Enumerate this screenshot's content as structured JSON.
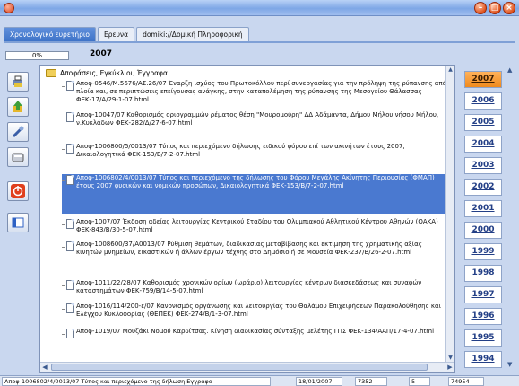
{
  "window": {
    "title": ""
  },
  "tabs": [
    {
      "label": "Χρονολογικό ευρετήριο"
    },
    {
      "label": "Ερευνα"
    },
    {
      "label": "domiki://Δομική Πληροφορική"
    }
  ],
  "progress": {
    "label": "0%",
    "value": 0
  },
  "current_year": "2007",
  "tree": {
    "folder": "Αποφάσεις, Εγκύκλιοι, Έγγραφα",
    "documents": [
      "Αποφ-0546/Μ.5676/ΑΣ.26/07 Έναρξη ισχύος του Πρωτοκόλλου περί συνεργασίας για την πρόληψη της ρύπανσης από πλοία και, σε περιπτώσεις επείγουσας ανάγκης, στην καταπολέμηση της ρύπανσης της Μεσογείου Θάλασσας ΦΕΚ-17/Α/29-1-07.html",
      "Αποφ-10047/07 Καθορισμός οριογραμμών ρέματος θέση \"Μουρομούρη\" ΔΔ Αδάμαντα, Δήμου Μήλου νήσου Μήλου, ν.Κυκλάδων ΦΕΚ-282/Δ/27-6-07.html",
      "Αποφ-1006800/5/0013/07 Τύπος και περιεχόμενο δήλωσης ειδικού φόρου επί των ακινήτων έτους 2007, Δικαιολογητικά ΦΕΚ-153/Β/7-2-07.html",
      "Αποφ-1006802/4/0013/07 Τύπος και περιεχόμενο της δήλωσης του Φόρου Μεγάλης Ακίνητης Περιουσίας (ΦΜΑΠ) έτους 2007 φυσικών και νομικών προσώπων, Δικαιολογητικά ΦΕΚ-153/Β/7-2-07.html",
      "Αποφ-1007/07 Έκδοση αδείας λειτουργίας Κεντρικού Σταδίου του Ολυμπιακού Αθλητικού Κέντρου Αθηνών (ΟΑΚΑ) ΦΕΚ-843/Β/30-5-07.html",
      "Αποφ-1008600/37/Α0013/07 Ρύθμιση θεμάτων, διαδικασίας μεταβίβασης και εκτίμηση της χρηματικής αξίας κινητών μνημείων, εικαστικών ή άλλων έργων τέχνης στο Δημόσιο ή σε Μουσεία ΦΕΚ-237/Β/26-2-07.html",
      "Αποφ-1011/22/28/07 Καθορισμός χρονικών ορίων (ωράριο) λειτουργίας κέντρων διασκεδάσεως και συναφών καταστημάτων ΦΕΚ-759/Β/14-5-07.html",
      "Αποφ-1016/114/200-ε/07 Κανονισμός οργάνωσης και λειτουργίας του Θαλάμου Επιχειρήσεων Παρακολούθησης και Ελέγχου Κυκλοφορίας (ΘΕΠΕΚ) ΦΕΚ-274/Β/1-3-07.html",
      "Αποφ-1019/07 Μουζάκι Νομού Καρδίτσας. Κίνηση διαδικασίας σύνταξης μελέτης ΓΠΣ ΦΕΚ-134/ΑΑΠ/17-4-07.html"
    ]
  },
  "years": [
    "2007",
    "2006",
    "2005",
    "2004",
    "2003",
    "2002",
    "2001",
    "2000",
    "1999",
    "1998",
    "1997",
    "1996",
    "1995",
    "1994"
  ],
  "status": {
    "doc": "Αποφ-1006802/4/0013/07 Τύπος και περιεχόμενο της δήλωση Εγγραφο",
    "date": "18/01/2007",
    "num1": "7352",
    "num2": "5",
    "num3": "74954"
  },
  "colors": {
    "accent": "#4a79d0",
    "active_year": "#f08a1d",
    "window_btn": "#e0531e"
  }
}
